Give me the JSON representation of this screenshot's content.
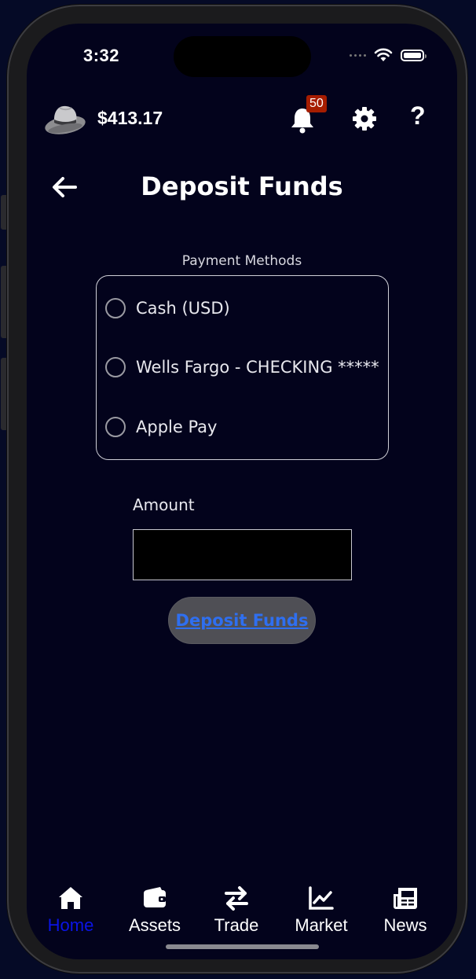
{
  "status_bar": {
    "time": "3:32"
  },
  "header": {
    "balance": "$413.17",
    "notification_count": "50",
    "help_label": "?"
  },
  "page": {
    "title": "Deposit Funds"
  },
  "payment_methods": {
    "label": "Payment Methods",
    "options": [
      {
        "label": "Cash (USD)",
        "selected": false
      },
      {
        "label": "Wells Fargo - CHECKING *****",
        "selected": false
      },
      {
        "label": "Apple Pay",
        "selected": false
      }
    ]
  },
  "amount": {
    "label": "Amount",
    "value": ""
  },
  "deposit_button": {
    "label": "Deposit Funds"
  },
  "tab_bar": {
    "active": "Home",
    "tabs": [
      {
        "label": "Home",
        "icon": "home-icon"
      },
      {
        "label": "Assets",
        "icon": "wallet-icon"
      },
      {
        "label": "Trade",
        "icon": "swap-arrows-icon"
      },
      {
        "label": "Market",
        "icon": "chart-line-icon"
      },
      {
        "label": "News",
        "icon": "newspaper-icon"
      }
    ]
  },
  "colors": {
    "background": "#03031c",
    "active_tab": "#0a14e6",
    "link": "#2f6ff0",
    "badge": "#a61d00"
  }
}
